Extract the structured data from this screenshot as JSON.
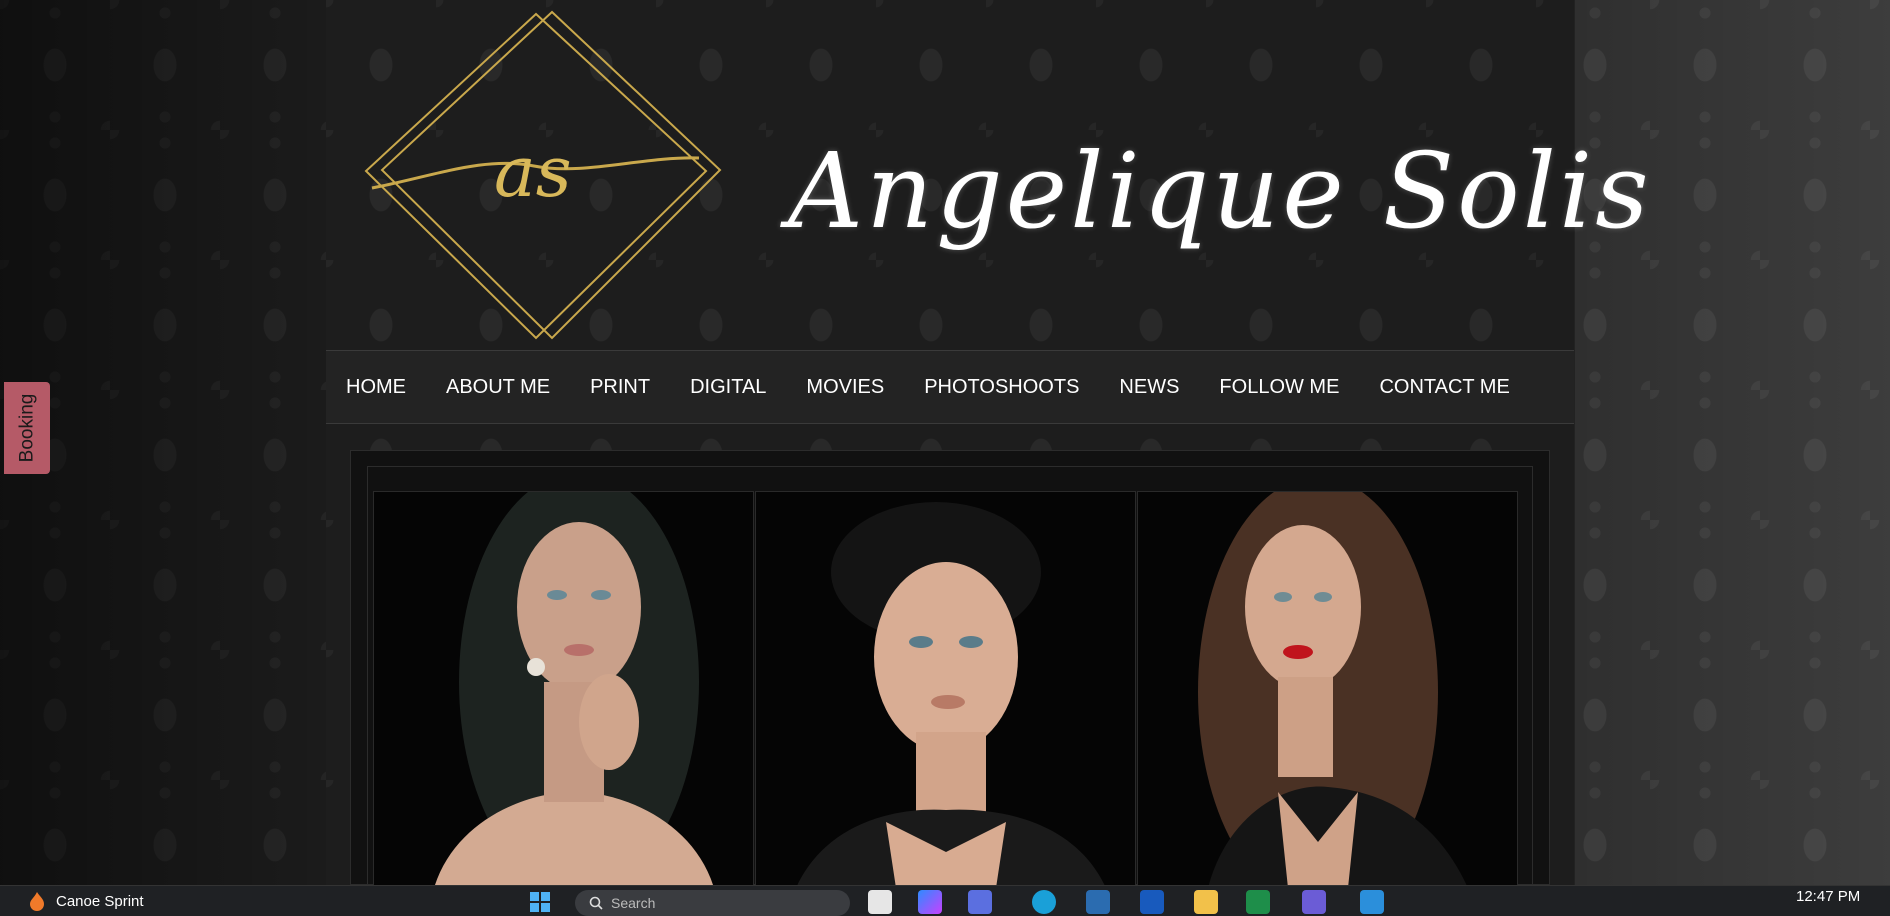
{
  "site": {
    "title": "Angelique Solis",
    "logo_monogram": "as"
  },
  "nav": {
    "items": [
      {
        "label": "HOME"
      },
      {
        "label": "ABOUT ME"
      },
      {
        "label": "PRINT"
      },
      {
        "label": "DIGITAL"
      },
      {
        "label": "MOVIES"
      },
      {
        "label": "PHOTOSHOOTS"
      },
      {
        "label": "NEWS"
      },
      {
        "label": "FOLLOW ME"
      },
      {
        "label": "CONTACT ME"
      }
    ]
  },
  "booking": {
    "label": "Booking"
  },
  "taskbar": {
    "app_label": "Canoe Sprint",
    "search_placeholder": "Search",
    "clock": "12:47 PM"
  },
  "colors": {
    "gold": "#c9a84c",
    "booking": "#b55a67",
    "nav_bg": "#232323"
  }
}
